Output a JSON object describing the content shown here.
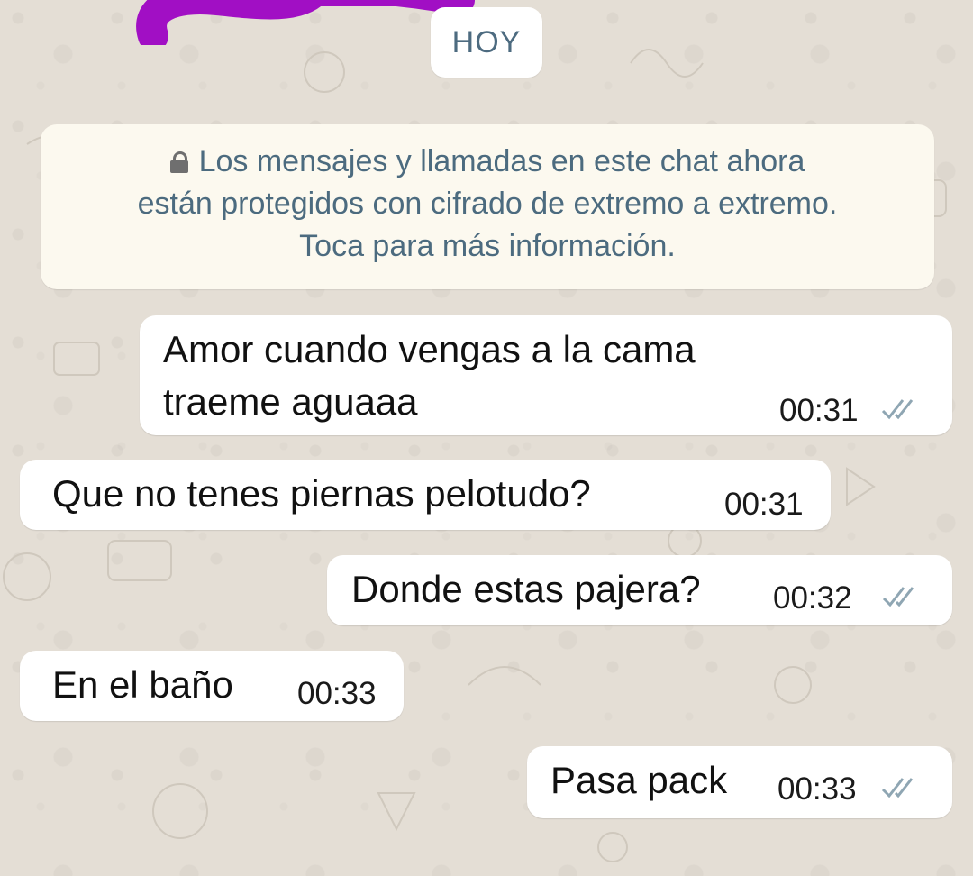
{
  "date_chip": "HOY",
  "encryption_notice": {
    "line1": "Los mensajes y llamadas en este chat ahora",
    "line2": "están protegidos con cifrado de extremo a extremo.",
    "line3": "Toca para más información."
  },
  "messages": [
    {
      "direction": "outgoing",
      "line1": "Amor cuando vengas a la cama",
      "line2": "traeme aguaaa",
      "time": "00:31",
      "status": "read-ticks-icon"
    },
    {
      "direction": "incoming",
      "text": "Que no tenes piernas pelotudo?",
      "time": "00:31"
    },
    {
      "direction": "outgoing",
      "text": "Donde estas pajera?",
      "time": "00:32",
      "status": "read-ticks-icon"
    },
    {
      "direction": "incoming",
      "text": "En el baño",
      "time": "00:33"
    },
    {
      "direction": "outgoing",
      "text": "Pasa pack",
      "time": "00:33",
      "status": "read-ticks-icon"
    }
  ],
  "colors": {
    "wallpaper": "#e4ded5",
    "bubble": "#ffffff",
    "system_text": "#4c6b7f",
    "ticks": "#8fa6b3",
    "scribble": "#a10fc4"
  }
}
